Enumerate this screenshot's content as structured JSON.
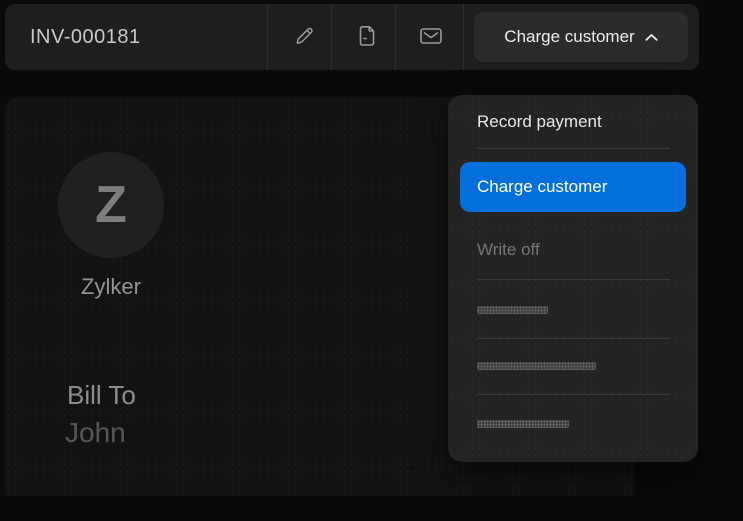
{
  "topbar": {
    "invoice_number": "INV-000181",
    "icons": [
      {
        "name": "pencil-edit-icon"
      },
      {
        "name": "document-pdf-icon"
      },
      {
        "name": "envelope-email-icon"
      }
    ],
    "charge_button_label": "Charge customer",
    "charge_button_chevron": "chevron-up"
  },
  "dropdown": {
    "items": [
      {
        "label": "Record payment",
        "state": "default"
      },
      {
        "label": "Charge customer",
        "state": "selected"
      },
      {
        "label": "Write off",
        "state": "dimmed"
      },
      {
        "type": "redacted-placeholder"
      },
      {
        "type": "redacted-placeholder"
      },
      {
        "type": "redacted-placeholder"
      }
    ]
  },
  "main": {
    "org_avatar_letter": "Z",
    "org_name": "Zylker",
    "bill_to_label": "Bill To",
    "bill_to_name": "John"
  },
  "colors": {
    "accent_blue": "#0570db",
    "page_bg": "#0a0a0a",
    "topbar_bg": "#1e1e1e",
    "panel_bg": "#121212",
    "menu_bg": "#232323",
    "divider": "#3a3a3a"
  }
}
